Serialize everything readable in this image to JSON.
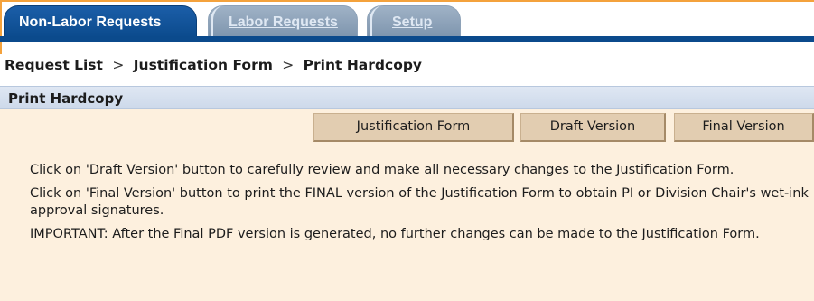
{
  "tabs": [
    {
      "label": "Non-Labor Requests",
      "active": true
    },
    {
      "label": "Labor Requests",
      "active": false
    },
    {
      "label": "Setup",
      "active": false
    }
  ],
  "breadcrumb": {
    "items": [
      "Request List",
      "Justification Form"
    ],
    "separator": ">",
    "current": "Print Hardcopy"
  },
  "panel": {
    "title": "Print Hardcopy",
    "buttons": {
      "justification": "Justification Form",
      "draft": "Draft Version",
      "final": "Final Version"
    },
    "paragraphs": [
      "Click on 'Draft Version' button to carefully review and make all necessary changes to the Justification Form.",
      "Click on 'Final Version' button to print the FINAL version of the Justification Form to obtain PI or Division Chair's wet-ink approval signatures.",
      "IMPORTANT: After the Final PDF version is generated, no further changes can be made to the Justification Form."
    ]
  },
  "colors": {
    "tab_active": "#0b4a8c",
    "tab_inactive": "#8fa5bc",
    "accent_orange": "#f4a23c",
    "panel_bg": "#fdf0de",
    "panel_header": "#d5dfee",
    "button_bg": "#e2cdb1"
  }
}
